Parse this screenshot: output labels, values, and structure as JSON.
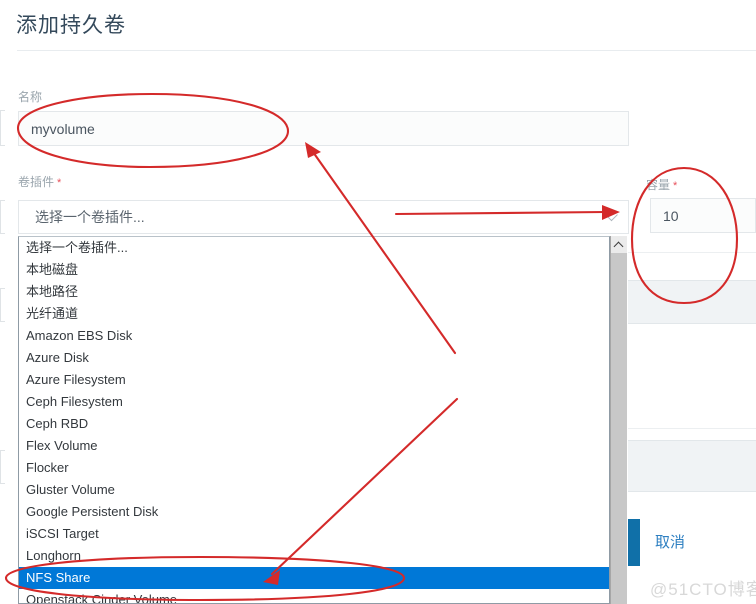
{
  "dialog": {
    "title": "添加持久卷"
  },
  "fields": {
    "name": {
      "label": "名称",
      "value": "myvolume",
      "placeholder": ""
    },
    "volume_plugin": {
      "label": "卷插件",
      "required_marker": "*",
      "selected": "选择一个卷插件...",
      "chevron_icon": "chevron-down-icon"
    },
    "capacity": {
      "label": "容量",
      "required_marker": "*",
      "value": "10",
      "placeholder": ""
    }
  },
  "dropdown": {
    "scroll_up_icon": "chevron-up-icon",
    "selected_index": 15,
    "options": [
      "选择一个卷插件...",
      "本地磁盘",
      "本地路径",
      "光纤通道",
      "Amazon EBS Disk",
      "Azure Disk",
      "Azure Filesystem",
      "Ceph Filesystem",
      "Ceph RBD",
      "Flex Volume",
      "Flocker",
      "Gluster Volume",
      "Google Persistent Disk",
      "iSCSI Target",
      "Longhorn",
      "NFS Share",
      "Openstack Cinder Volume"
    ]
  },
  "footer": {
    "cancel_label": "取消"
  },
  "watermark": {
    "text": "@51CTO博客"
  },
  "colors": {
    "accent_blue": "#0078d7",
    "button_blue": "#1070a8",
    "link_blue": "#2d7fc1",
    "required_red": "#e8505b",
    "annotation_red": "#d42a2a",
    "title_text": "#34495b"
  },
  "annotations": {
    "ellipse_name_field": "hand-drawn-ellipse",
    "ellipse_capacity_field": "hand-drawn-ellipse",
    "ellipse_nfs_share_option": "hand-drawn-ellipse",
    "arrow_to_name_field": "hand-drawn-arrow",
    "arrow_to_plugin_select": "hand-drawn-arrow",
    "arrow_to_nfs_share": "hand-drawn-arrow"
  }
}
